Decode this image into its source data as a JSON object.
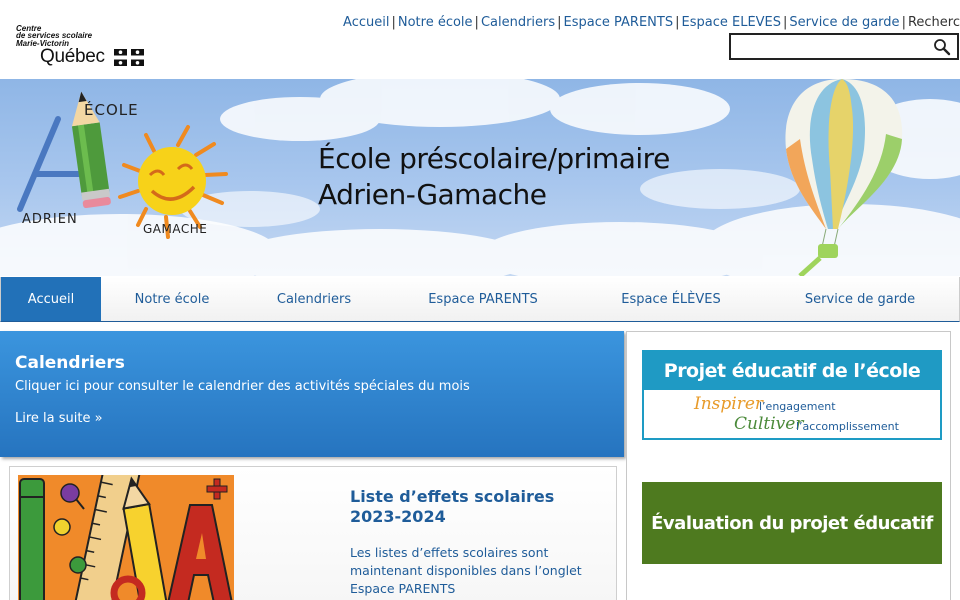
{
  "logo": {
    "line1": "Centre",
    "line2": "de services scolaire",
    "line3": "Marie-Victorin",
    "line4": "Québec"
  },
  "toplinks": [
    {
      "label": "Accueil"
    },
    {
      "label": "Notre école"
    },
    {
      "label": "Calendriers"
    },
    {
      "label": "Espace PARENTS"
    },
    {
      "label": "Espace ÉLÈVES"
    },
    {
      "label": "Service de garde"
    }
  ],
  "toplinks_tail": "Recherc",
  "search": {
    "value": "",
    "placeholder": ""
  },
  "banner": {
    "title_line1": "École préscolaire/primaire",
    "title_line2": "Adrien-Gamache",
    "logo_word_ecole": "ÉCOLE",
    "logo_word_adrien": "ADRIEN",
    "logo_word_gamache": "GAMACHE"
  },
  "nav": [
    {
      "label": "Accueil",
      "active": true
    },
    {
      "label": "Notre école"
    },
    {
      "label": "Calendriers"
    },
    {
      "label": "Espace PARENTS"
    },
    {
      "label": "Espace ÉLÈVES"
    },
    {
      "label": "Service de garde"
    }
  ],
  "calendar_box": {
    "title": "Calendriers",
    "text": "Cliquer ici pour consulter le calendrier des activités spéciales du mois",
    "more": "Lire la suite »"
  },
  "article": {
    "title": "Liste d’effets scolaires 2023-2024",
    "text": "Les listes d’effets scolaires sont maintenant disponibles dans l’onglet Espace PARENTS"
  },
  "sidebar": {
    "promo1_title": "Projet éducatif de l’école",
    "promo1_word1": "Inspirer",
    "promo1_rest1": "l’engagement",
    "promo1_word2": "Cultiver",
    "promo1_rest2": "l’accomplissement",
    "promo2_title": "Évaluation du projet éducatif"
  },
  "colors": {
    "link": "#1f5c99",
    "nav_active": "#2271b8",
    "calendar_box": "#2f86d2",
    "promo1_band": "#1f9ac4",
    "promo2_bg": "#4e7a1f"
  }
}
